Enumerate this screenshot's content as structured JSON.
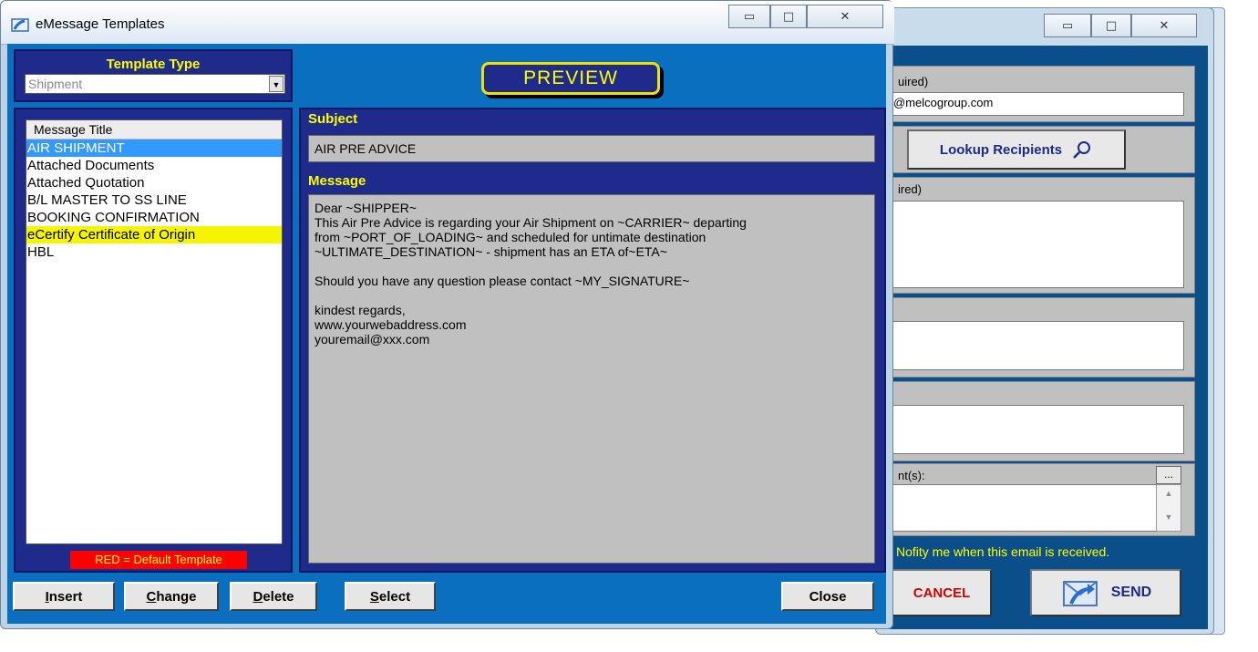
{
  "window": {
    "title": "eMessage Templates",
    "controls": {
      "minimize": "▭",
      "maximize": "□",
      "close": "✕"
    }
  },
  "template_type": {
    "label": "Template Type",
    "selected": "Shipment",
    "arrow": "▼"
  },
  "message_list": {
    "header": "Message Title",
    "items": [
      {
        "label": "AIR SHIPMENT",
        "state": "selected"
      },
      {
        "label": "Attached Documents",
        "state": "normal"
      },
      {
        "label": "Attached Quotation",
        "state": "normal"
      },
      {
        "label": "B/L MASTER TO SS LINE",
        "state": "normal"
      },
      {
        "label": "BOOKING CONFIRMATION",
        "state": "normal"
      },
      {
        "label": "eCertify Certificate of Origin",
        "state": "highlighted"
      },
      {
        "label": "HBL",
        "state": "normal"
      }
    ],
    "default_note": "RED = Default Template"
  },
  "preview": {
    "badge": "PREVIEW",
    "subject_label": "Subject",
    "subject_value": "AIR PRE ADVICE",
    "message_label": "Message",
    "message_value": "Dear ~SHIPPER~\nThis Air Pre Advice is regarding your Air Shipment on ~CARRIER~ departing\nfrom ~PORT_OF_LOADING~ and scheduled for untimate destination\n~ULTIMATE_DESTINATION~ - shipment has an ETA of~ETA~\n\nShould you have any question please contact ~MY_SIGNATURE~\n\nkindest regards,\nwww.yourwebaddress.com\nyouremail@xxx.com"
  },
  "buttons": {
    "insert": {
      "first": "I",
      "rest": "nsert"
    },
    "change": {
      "first": "C",
      "rest": "hange"
    },
    "delete": {
      "first": "D",
      "rest": "elete"
    },
    "select": {
      "first": "S",
      "rest": "elect"
    },
    "close": "Close"
  },
  "background_window": {
    "controls": {
      "minimize": "▭",
      "maximize": "□",
      "close": "✕"
    },
    "to_label": "uired)",
    "to_value": "@melcogroup.com",
    "lookup_button": "Lookup Recipients",
    "cc_label": "ired)",
    "attachments_label": "nt(s):",
    "attach_button": "...",
    "notify_text": "Nofity me when this email is received.",
    "cancel_button": "CANCEL",
    "send_button": "SEND"
  },
  "colors": {
    "client_blue": "#0b6fc0",
    "panel_navy": "#1e2b8a",
    "label_yellow": "#ffff00",
    "selected_blue": "#3399ff",
    "highlight_yellow": "#f5f500",
    "default_red": "#ff0000"
  }
}
